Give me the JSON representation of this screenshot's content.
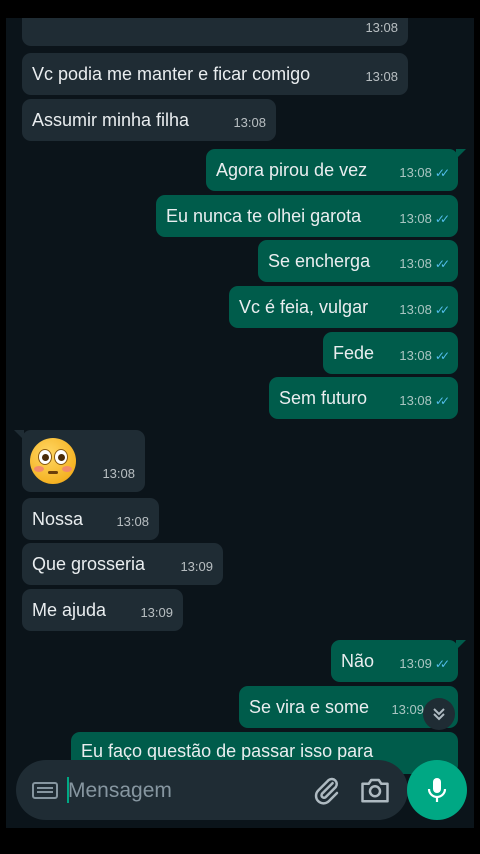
{
  "messages": [
    {
      "dir": "in",
      "text": "",
      "time": "13:08"
    },
    {
      "dir": "in",
      "text": "Vc podia me manter e ficar comigo",
      "time": "13:08"
    },
    {
      "dir": "in",
      "text": "Assumir minha filha",
      "time": "13:08"
    },
    {
      "dir": "out",
      "text": "Agora pirou de vez",
      "time": "13:08",
      "read": true
    },
    {
      "dir": "out",
      "text": "Eu nunca te olhei garota",
      "time": "13:08",
      "read": true
    },
    {
      "dir": "out",
      "text": "Se encherga",
      "time": "13:08",
      "read": true
    },
    {
      "dir": "out",
      "text": "Vc é feia, vulgar",
      "time": "13:08",
      "read": true
    },
    {
      "dir": "out",
      "text": "Fede",
      "time": "13:08",
      "read": true
    },
    {
      "dir": "out",
      "text": "Sem futuro",
      "time": "13:08",
      "read": true
    },
    {
      "dir": "in",
      "emoji": "flushed-face",
      "text": "",
      "time": "13:08"
    },
    {
      "dir": "in",
      "text": "Nossa",
      "time": "13:08"
    },
    {
      "dir": "in",
      "text": "Que grosseria",
      "time": "13:09"
    },
    {
      "dir": "in",
      "text": "Me ajuda",
      "time": "13:09"
    },
    {
      "dir": "out",
      "text": "Não",
      "time": "13:09",
      "read": true
    },
    {
      "dir": "out",
      "text": "Se vira e some",
      "time": "13:09",
      "read": true
    },
    {
      "dir": "out",
      "text": "Eu faço questão de passar isso para",
      "time": "",
      "read": false
    }
  ],
  "composer": {
    "placeholder": "Mensagem",
    "keyboard_icon": "keyboard-icon",
    "attach_icon": "paperclip-icon",
    "camera_icon": "camera-icon",
    "send_icon": "microphone-icon"
  },
  "scroll_down_icon": "double-chevron-down-icon",
  "colors": {
    "background": "#0b141a",
    "incoming_bubble": "#1f2c34",
    "outgoing_bubble": "#005c4b",
    "accent": "#00a884",
    "read_ticks": "#53bdeb"
  }
}
